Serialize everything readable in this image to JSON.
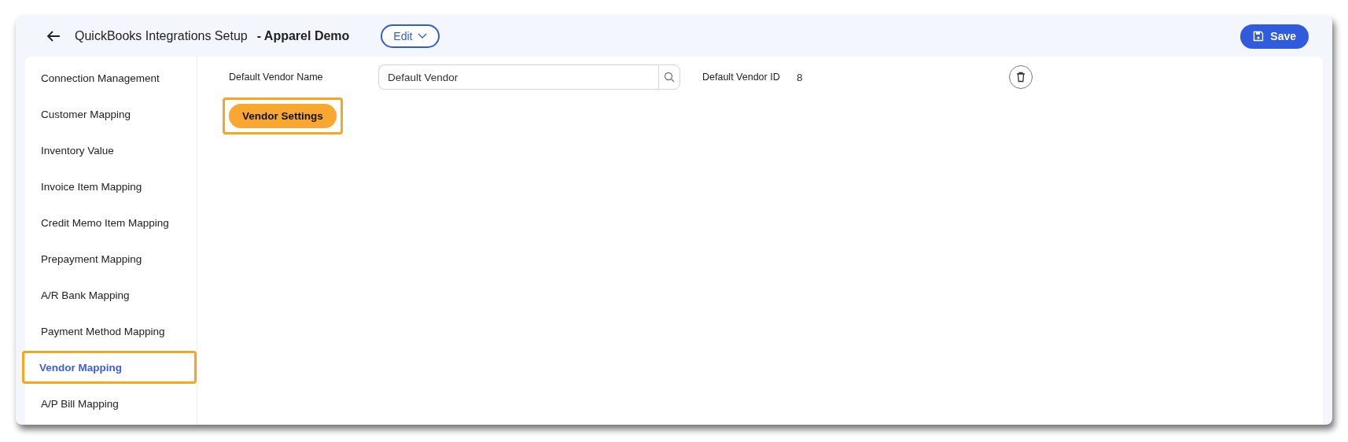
{
  "header": {
    "title": "QuickBooks Integrations Setup",
    "company": "- Apparel Demo",
    "edit_button": "Edit",
    "save_button": "Save"
  },
  "sidebar": {
    "items": [
      {
        "label": "Connection Management",
        "selected": false,
        "highlighted": false
      },
      {
        "label": "Customer Mapping",
        "selected": false,
        "highlighted": false
      },
      {
        "label": "Inventory Value",
        "selected": false,
        "highlighted": false
      },
      {
        "label": "Invoice Item Mapping",
        "selected": false,
        "highlighted": false
      },
      {
        "label": "Credit Memo Item Mapping",
        "selected": false,
        "highlighted": false
      },
      {
        "label": "Prepayment Mapping",
        "selected": false,
        "highlighted": false
      },
      {
        "label": "A/R Bank Mapping",
        "selected": false,
        "highlighted": false
      },
      {
        "label": "Payment Method Mapping",
        "selected": false,
        "highlighted": false
      },
      {
        "label": "Vendor Mapping",
        "selected": true,
        "highlighted": true
      },
      {
        "label": "A/P Bill Mapping",
        "selected": false,
        "highlighted": false
      }
    ]
  },
  "form": {
    "name_label": "Default Vendor Name",
    "name_value": "Default Vendor",
    "id_label": "Default Vendor ID",
    "id_value": "8",
    "settings_button": {
      "label": "Vendor Settings",
      "highlighted": true
    }
  }
}
